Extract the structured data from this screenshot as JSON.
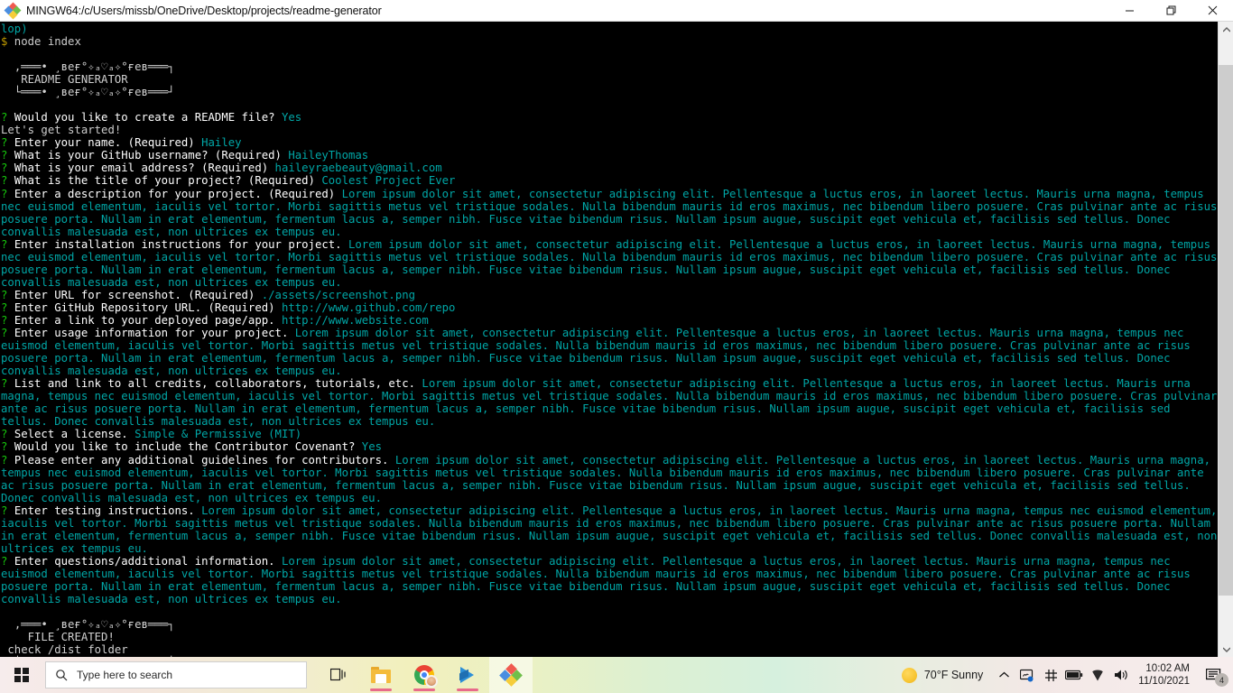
{
  "window": {
    "title": "MINGW64:/c/Users/missb/OneDrive/Desktop/projects/readme-generator",
    "app_icon": "git-bash-icon",
    "minimize_label": "—",
    "maximize_label": "❐",
    "close_label": "✕"
  },
  "terminal": {
    "prompt_path_tail": "lop)",
    "prompt_symbol": "$",
    "command": " node index",
    "banner": {
      "top": "  ,═══• ¸ʙеғ°✧ₐ♡ₐ✧°ғеʙ═══┐",
      "label": "   README GENERATOR",
      "bottom": "  └═══• ¸ʙеғ°✧ₐ♡ₐ✧°ғеʙ═══┘"
    },
    "footer_banner": {
      "top": "  ,═══• ¸ʙеғ°✧ₐ♡ₐ✧°ғеʙ═══┐",
      "line1": "    FILE CREATED!",
      "line2": " check /dist folder",
      "bottom": "  └═══• ¸ʙеғ°✧ₐ♡ₐ✧°ғеʙ═══┘"
    },
    "status_line": "Let's get started!",
    "marker": "?",
    "lorem_long": "Lorem ipsum dolor sit amet, consectetur adipiscing elit. Pellentesque a luctus eros, in laoreet lectus. Mauris urna magna, tempus nec euismod elementum, iaculis vel tortor. Morbi sagittis metus vel tristique sodales. Nulla bibendum mauris id eros maximus, nec bibendum libero posuere. Cras pulvinar ante ac risus posuere porta. Nullam in erat elementum, fermentum lacus a, semper nibh. Fusce vitae bibendum risus. Nullam ipsum augue, suscipit eget vehicula et, facilisis sed tellus. Donec convallis malesuada est, non ultrices ex tempus eu.",
    "prompts": [
      {
        "question": "Would you like to create a README file?",
        "answer": "Yes",
        "answer_kind": "short"
      },
      {
        "question": "Enter your name. (Required)",
        "answer": "Hailey",
        "answer_kind": "short"
      },
      {
        "question": "What is your GitHub username? (Required)",
        "answer": "HaileyThomas",
        "answer_kind": "short"
      },
      {
        "question": "What is your email address? (Required)",
        "answer": "haileyraebeauty@gmail.com",
        "answer_kind": "short"
      },
      {
        "question": "What is the title of your project? (Required)",
        "answer": "Coolest Project Ever",
        "answer_kind": "short"
      },
      {
        "question": "Enter a description for your project. (Required)",
        "answer": "LOREM",
        "answer_kind": "long"
      },
      {
        "question": "Enter installation instructions for your project.",
        "answer": "LOREM",
        "answer_kind": "long"
      },
      {
        "question": "Enter URL for screenshot. (Required)",
        "answer": "./assets/screenshot.png",
        "answer_kind": "short"
      },
      {
        "question": "Enter GitHub Repository URL. (Required)",
        "answer": "http://www.github.com/repo",
        "answer_kind": "short"
      },
      {
        "question": "Enter a link to your deployed page/app.",
        "answer": "http://www.website.com",
        "answer_kind": "short"
      },
      {
        "question": "Enter usage information for your project.",
        "answer": "LOREM",
        "answer_kind": "long"
      },
      {
        "question": "List and link to all credits, collaborators, tutorials, etc.",
        "answer": "LOREM",
        "answer_kind": "long"
      },
      {
        "question": "Select a license.",
        "answer": "Simple & Permissive (MIT)",
        "answer_kind": "short"
      },
      {
        "question": "Would you like to include the Contributor Covenant?",
        "answer": "Yes",
        "answer_kind": "short"
      },
      {
        "question": "Please enter any additional guidelines for contributors.",
        "answer": "LOREM",
        "answer_kind": "long"
      },
      {
        "question": "Enter testing instructions.",
        "answer": "LOREM",
        "answer_kind": "long"
      },
      {
        "question": "Enter questions/additional information.",
        "answer": "LOREM",
        "answer_kind": "long"
      }
    ]
  },
  "scrollbar": {
    "up_arrow": "▲",
    "down_arrow": "▼"
  },
  "taskbar": {
    "start_label": "Start",
    "search_placeholder": "Type here to search",
    "task_view_label": "Task View",
    "apps": [
      {
        "name": "file-explorer",
        "label": "File Explorer",
        "active": false
      },
      {
        "name": "chrome",
        "label": "Google Chrome",
        "active": false
      },
      {
        "name": "vscode",
        "label": "Visual Studio Code",
        "active": false
      },
      {
        "name": "git-bash",
        "label": "Git Bash",
        "active": true
      }
    ],
    "weather": {
      "temperature": "70°F",
      "condition": "Sunny",
      "combined": "70°F  Sunny"
    },
    "clock": {
      "time": "10:02 AM",
      "date": "11/10/2021"
    },
    "notifications": {
      "count": "4"
    }
  },
  "colors": {
    "terminal_bg": "#000000",
    "text": "#cccccc",
    "answer_cyan": "#00a6a6",
    "marker_green": "#16c60c",
    "prompt_yellow": "#c19c00",
    "accent_pink": "#e86a8a"
  }
}
